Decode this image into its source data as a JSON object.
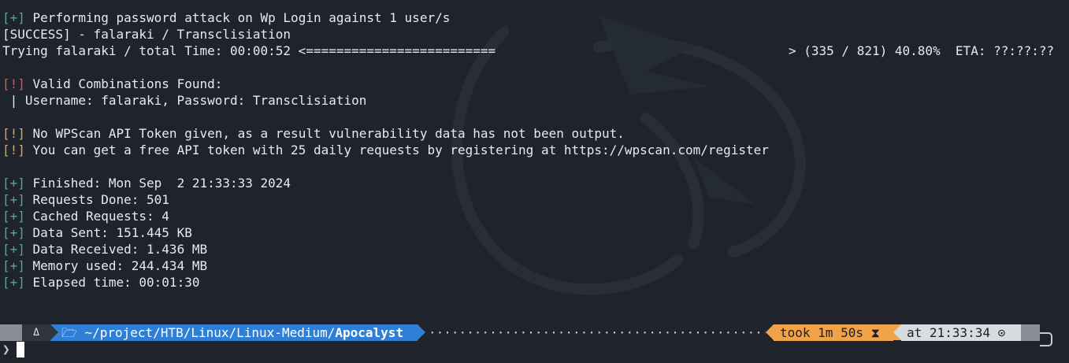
{
  "terminal": {
    "lines": {
      "attack_tag": "[+]",
      "attack_text": " Performing password attack on Wp Login against 1 user/s",
      "success_line": "[SUCCESS] - falaraki / Transclisiation",
      "progress_left": "Trying falaraki / total Time: 00:00:52 <=========================",
      "progress_right": "> (335 / 821) 40.80%  ETA: ??:??:??",
      "valid_tag": "[!]",
      "valid_text": " Valid Combinations Found:",
      "credentials": " | Username: falaraki, Password: Transclisiation",
      "token_tag": "[!]",
      "token_text": " No WPScan API Token given, as a result vulnerability data has not been output.",
      "free_tag": "[!]",
      "free_text": " You can get a free API token with 25 daily requests by registering at https://wpscan.com/register",
      "finished_tag": "[+]",
      "finished_text": " Finished: Mon Sep  2 21:33:33 2024",
      "requests_tag": "[+]",
      "requests_text": " Requests Done: 501",
      "cached_tag": "[+]",
      "cached_text": " Cached Requests: 4",
      "sent_tag": "[+]",
      "sent_text": " Data Sent: 151.445 KB",
      "received_tag": "[+]",
      "received_text": " Data Received: 1.436 MB",
      "memory_tag": "[+]",
      "memory_text": " Memory used: 244.434 MB",
      "elapsed_tag": "[+]",
      "elapsed_text": " Elapsed time: 00:01:30"
    }
  },
  "prompt": {
    "os_icon": "Δ",
    "folder_icon": "🗁",
    "path_prefix": "~/project/HTB/Linux/Linux-Medium/",
    "path_current": "Apocalyst",
    "dots": "········································································",
    "took_text": "took 1m 50s ",
    "hourglass_icon": "⧗",
    "at_text": "at 21:33:34 ",
    "clock_icon": "⊙",
    "caret": "❯"
  },
  "colors": {
    "background": "#1e232c",
    "tag_plus": "#4aa8a8",
    "tag_bang_red": "#e0555b",
    "tag_bang_orange": "#e8a34a",
    "path_segment": "#2f7fd6",
    "took_segment": "#f1a34b",
    "at_segment": "#d8dbe0"
  }
}
